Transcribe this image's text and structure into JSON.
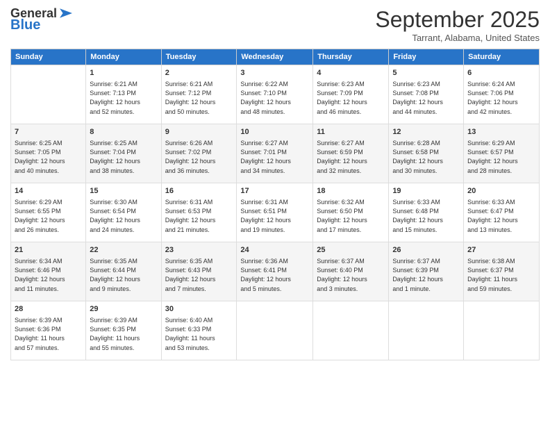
{
  "header": {
    "logo_general": "General",
    "logo_blue": "Blue",
    "month_title": "September 2025",
    "location": "Tarrant, Alabama, United States"
  },
  "columns": [
    "Sunday",
    "Monday",
    "Tuesday",
    "Wednesday",
    "Thursday",
    "Friday",
    "Saturday"
  ],
  "weeks": [
    [
      {
        "day": "",
        "content": ""
      },
      {
        "day": "1",
        "content": "Sunrise: 6:21 AM\nSunset: 7:13 PM\nDaylight: 12 hours\nand 52 minutes."
      },
      {
        "day": "2",
        "content": "Sunrise: 6:21 AM\nSunset: 7:12 PM\nDaylight: 12 hours\nand 50 minutes."
      },
      {
        "day": "3",
        "content": "Sunrise: 6:22 AM\nSunset: 7:10 PM\nDaylight: 12 hours\nand 48 minutes."
      },
      {
        "day": "4",
        "content": "Sunrise: 6:23 AM\nSunset: 7:09 PM\nDaylight: 12 hours\nand 46 minutes."
      },
      {
        "day": "5",
        "content": "Sunrise: 6:23 AM\nSunset: 7:08 PM\nDaylight: 12 hours\nand 44 minutes."
      },
      {
        "day": "6",
        "content": "Sunrise: 6:24 AM\nSunset: 7:06 PM\nDaylight: 12 hours\nand 42 minutes."
      }
    ],
    [
      {
        "day": "7",
        "content": "Sunrise: 6:25 AM\nSunset: 7:05 PM\nDaylight: 12 hours\nand 40 minutes."
      },
      {
        "day": "8",
        "content": "Sunrise: 6:25 AM\nSunset: 7:04 PM\nDaylight: 12 hours\nand 38 minutes."
      },
      {
        "day": "9",
        "content": "Sunrise: 6:26 AM\nSunset: 7:02 PM\nDaylight: 12 hours\nand 36 minutes."
      },
      {
        "day": "10",
        "content": "Sunrise: 6:27 AM\nSunset: 7:01 PM\nDaylight: 12 hours\nand 34 minutes."
      },
      {
        "day": "11",
        "content": "Sunrise: 6:27 AM\nSunset: 6:59 PM\nDaylight: 12 hours\nand 32 minutes."
      },
      {
        "day": "12",
        "content": "Sunrise: 6:28 AM\nSunset: 6:58 PM\nDaylight: 12 hours\nand 30 minutes."
      },
      {
        "day": "13",
        "content": "Sunrise: 6:29 AM\nSunset: 6:57 PM\nDaylight: 12 hours\nand 28 minutes."
      }
    ],
    [
      {
        "day": "14",
        "content": "Sunrise: 6:29 AM\nSunset: 6:55 PM\nDaylight: 12 hours\nand 26 minutes."
      },
      {
        "day": "15",
        "content": "Sunrise: 6:30 AM\nSunset: 6:54 PM\nDaylight: 12 hours\nand 24 minutes."
      },
      {
        "day": "16",
        "content": "Sunrise: 6:31 AM\nSunset: 6:53 PM\nDaylight: 12 hours\nand 21 minutes."
      },
      {
        "day": "17",
        "content": "Sunrise: 6:31 AM\nSunset: 6:51 PM\nDaylight: 12 hours\nand 19 minutes."
      },
      {
        "day": "18",
        "content": "Sunrise: 6:32 AM\nSunset: 6:50 PM\nDaylight: 12 hours\nand 17 minutes."
      },
      {
        "day": "19",
        "content": "Sunrise: 6:33 AM\nSunset: 6:48 PM\nDaylight: 12 hours\nand 15 minutes."
      },
      {
        "day": "20",
        "content": "Sunrise: 6:33 AM\nSunset: 6:47 PM\nDaylight: 12 hours\nand 13 minutes."
      }
    ],
    [
      {
        "day": "21",
        "content": "Sunrise: 6:34 AM\nSunset: 6:46 PM\nDaylight: 12 hours\nand 11 minutes."
      },
      {
        "day": "22",
        "content": "Sunrise: 6:35 AM\nSunset: 6:44 PM\nDaylight: 12 hours\nand 9 minutes."
      },
      {
        "day": "23",
        "content": "Sunrise: 6:35 AM\nSunset: 6:43 PM\nDaylight: 12 hours\nand 7 minutes."
      },
      {
        "day": "24",
        "content": "Sunrise: 6:36 AM\nSunset: 6:41 PM\nDaylight: 12 hours\nand 5 minutes."
      },
      {
        "day": "25",
        "content": "Sunrise: 6:37 AM\nSunset: 6:40 PM\nDaylight: 12 hours\nand 3 minutes."
      },
      {
        "day": "26",
        "content": "Sunrise: 6:37 AM\nSunset: 6:39 PM\nDaylight: 12 hours\nand 1 minute."
      },
      {
        "day": "27",
        "content": "Sunrise: 6:38 AM\nSunset: 6:37 PM\nDaylight: 11 hours\nand 59 minutes."
      }
    ],
    [
      {
        "day": "28",
        "content": "Sunrise: 6:39 AM\nSunset: 6:36 PM\nDaylight: 11 hours\nand 57 minutes."
      },
      {
        "day": "29",
        "content": "Sunrise: 6:39 AM\nSunset: 6:35 PM\nDaylight: 11 hours\nand 55 minutes."
      },
      {
        "day": "30",
        "content": "Sunrise: 6:40 AM\nSunset: 6:33 PM\nDaylight: 11 hours\nand 53 minutes."
      },
      {
        "day": "",
        "content": ""
      },
      {
        "day": "",
        "content": ""
      },
      {
        "day": "",
        "content": ""
      },
      {
        "day": "",
        "content": ""
      }
    ]
  ]
}
